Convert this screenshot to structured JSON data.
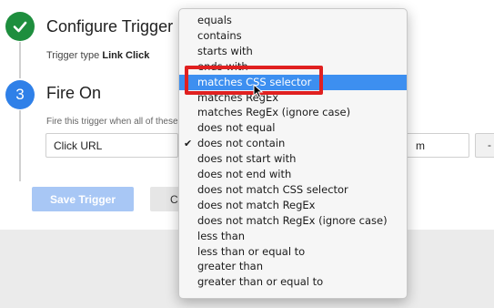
{
  "steps": {
    "configure": {
      "title": "Configure Trigger",
      "type_label": "Trigger type",
      "type_value": "Link Click"
    },
    "fire_on": {
      "number": "3",
      "title": "Fire On",
      "description": "Fire this trigger when all of these"
    }
  },
  "condition": {
    "variable": "Click URL",
    "value_suffix": "m",
    "remove_label": "-"
  },
  "buttons": {
    "save": "Save Trigger",
    "cancel": "C"
  },
  "dropdown": {
    "highlighted": "matches CSS selector",
    "checked": "does not contain",
    "options": [
      "equals",
      "contains",
      "starts with",
      "ends with",
      "matches CSS selector",
      "matches RegEx",
      "matches RegEx (ignore case)",
      "does not equal",
      "does not contain",
      "does not start with",
      "does not end with",
      "does not match CSS selector",
      "does not match RegEx",
      "does not match RegEx (ignore case)",
      "less than",
      "less than or equal to",
      "greater than",
      "greater than or equal to"
    ]
  },
  "colors": {
    "success_green": "#1e8e3e",
    "step_blue": "#2f80e8",
    "highlight_blue": "#3d8ff0",
    "annotation_red": "#e02020",
    "save_button_disabled": "#a8c7f5"
  }
}
